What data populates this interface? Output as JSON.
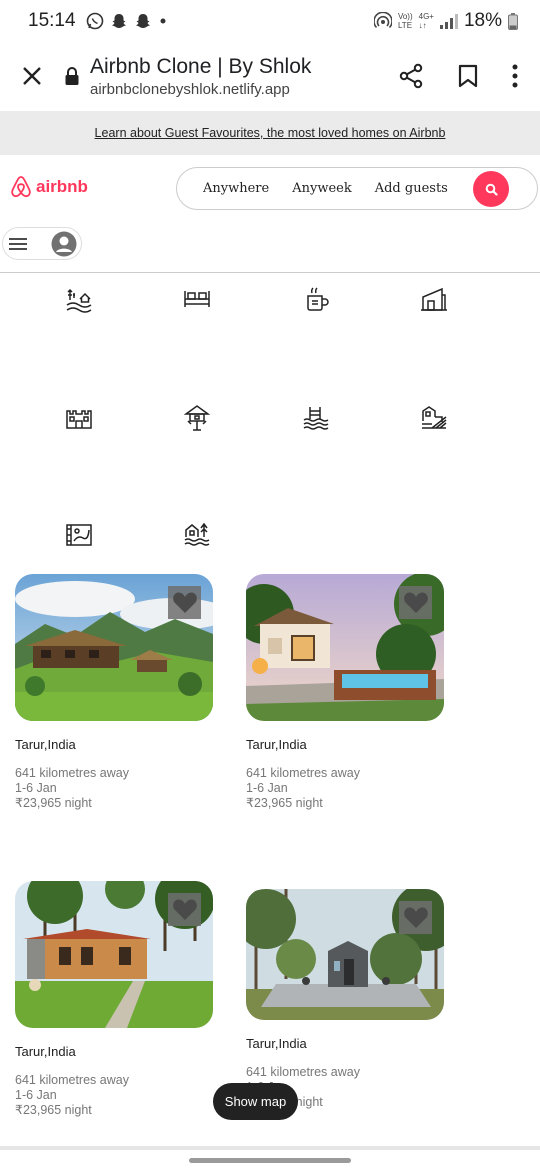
{
  "status": {
    "time": "15:14",
    "volte_top": "Vo))",
    "volte_bottom": "LTE",
    "net_top": "4G+",
    "net_bottom": "↓↑",
    "battery": "18%"
  },
  "browser": {
    "title": "Airbnb Clone | By Shlok",
    "url": "airbnbclonebyshlok.netlify.app"
  },
  "banner": {
    "text": "Learn about Guest Favourites, the most loved homes on Airbnb"
  },
  "header": {
    "logo_text": "airbnb",
    "search": {
      "anywhere": "Anywhere",
      "anyweek": "Anyweek",
      "add_guests": "Add guests"
    }
  },
  "categories": [
    {
      "icon": "beach-landscape-icon"
    },
    {
      "icon": "bed-icon"
    },
    {
      "icon": "mug-icon"
    },
    {
      "icon": "house-icon"
    },
    {
      "icon": "castle-icon"
    },
    {
      "icon": "treehouse-icon"
    },
    {
      "icon": "pool-icon"
    },
    {
      "icon": "lakeside-house-icon"
    },
    {
      "icon": "map-icon"
    },
    {
      "icon": "waterfront-house-icon"
    }
  ],
  "listings": [
    {
      "location": "Tarur,India",
      "distance": "641 kilometres away",
      "dates": "1-6 Jan",
      "price": "₹23,965 night"
    },
    {
      "location": "Tarur,India",
      "distance": "641 kilometres away",
      "dates": "1-6 Jan",
      "price": "₹23,965 night"
    },
    {
      "location": "Tarur,India",
      "distance": "641 kilometres away",
      "dates": "1-6 Jan",
      "price": "₹23,965 night"
    },
    {
      "location": "Tarur,India",
      "distance": "641 kilometres away",
      "dates": "1-6 Jan",
      "price": "₹23,965 night"
    }
  ],
  "show_map": "Show map",
  "colors": {
    "brand": "#ff385c",
    "banner_bg": "#ebebeb",
    "dark_button": "#222222"
  }
}
